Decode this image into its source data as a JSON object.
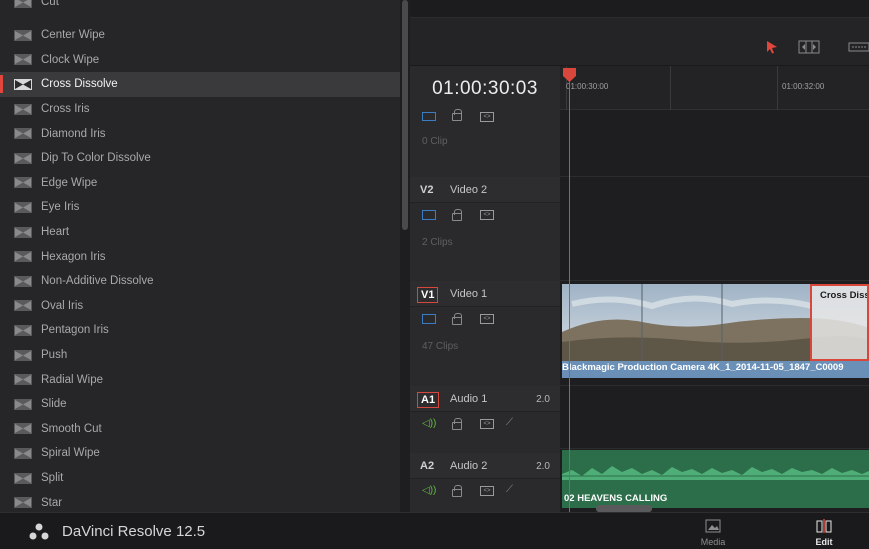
{
  "transitions": {
    "top_partial": "Cut",
    "items": [
      {
        "label": "Center Wipe"
      },
      {
        "label": "Clock Wipe"
      },
      {
        "label": "Cross Dissolve",
        "selected": true
      },
      {
        "label": "Cross Iris"
      },
      {
        "label": "Diamond Iris"
      },
      {
        "label": "Dip To Color Dissolve"
      },
      {
        "label": "Edge Wipe"
      },
      {
        "label": "Eye Iris"
      },
      {
        "label": "Heart"
      },
      {
        "label": "Hexagon Iris"
      },
      {
        "label": "Non-Additive Dissolve"
      },
      {
        "label": "Oval Iris"
      },
      {
        "label": "Pentagon Iris"
      },
      {
        "label": "Push"
      },
      {
        "label": "Radial Wipe"
      },
      {
        "label": "Slide"
      },
      {
        "label": "Smooth Cut"
      },
      {
        "label": "Spiral Wipe"
      },
      {
        "label": "Split"
      },
      {
        "label": "Star"
      }
    ],
    "icon": "transition-icon"
  },
  "timeline": {
    "timecode": "01:00:30:03",
    "ruler": [
      "01:00:30:00",
      "01:00:32:00"
    ],
    "tracks": {
      "v3_clips": "0 Clip",
      "v2": {
        "id": "V2",
        "name": "Video 2",
        "clips": "2 Clips"
      },
      "v1": {
        "id": "V1",
        "name": "Video 1",
        "clips": "47 Clips"
      },
      "a1": {
        "id": "A1",
        "name": "Audio 1",
        "db": "2.0"
      },
      "a2": {
        "id": "A2",
        "name": "Audio 2",
        "db": "2.0"
      }
    },
    "video_clip_name": "Blackmagic Production Camera 4K_1_2014-11-05_1847_C0009",
    "transition_label": "Cross Dissolve",
    "audio_clip_name": "02 HEAVENS CALLING"
  },
  "toolbar": {
    "icons": [
      "selection-arrow-icon",
      "trim-icon",
      "blade-icon"
    ]
  },
  "bottom_bar": {
    "app_name": "DaVinci Resolve 12.5",
    "pages": [
      {
        "label": "Media",
        "icon": "media-icon"
      },
      {
        "label": "Edit",
        "icon": "edit-icon",
        "active": true
      }
    ]
  },
  "colors": {
    "accent": "#d9463b",
    "video_clip": "#6a90b8",
    "audio_clip": "#2b6e49",
    "audio_enabled": "#5fbf3f"
  }
}
